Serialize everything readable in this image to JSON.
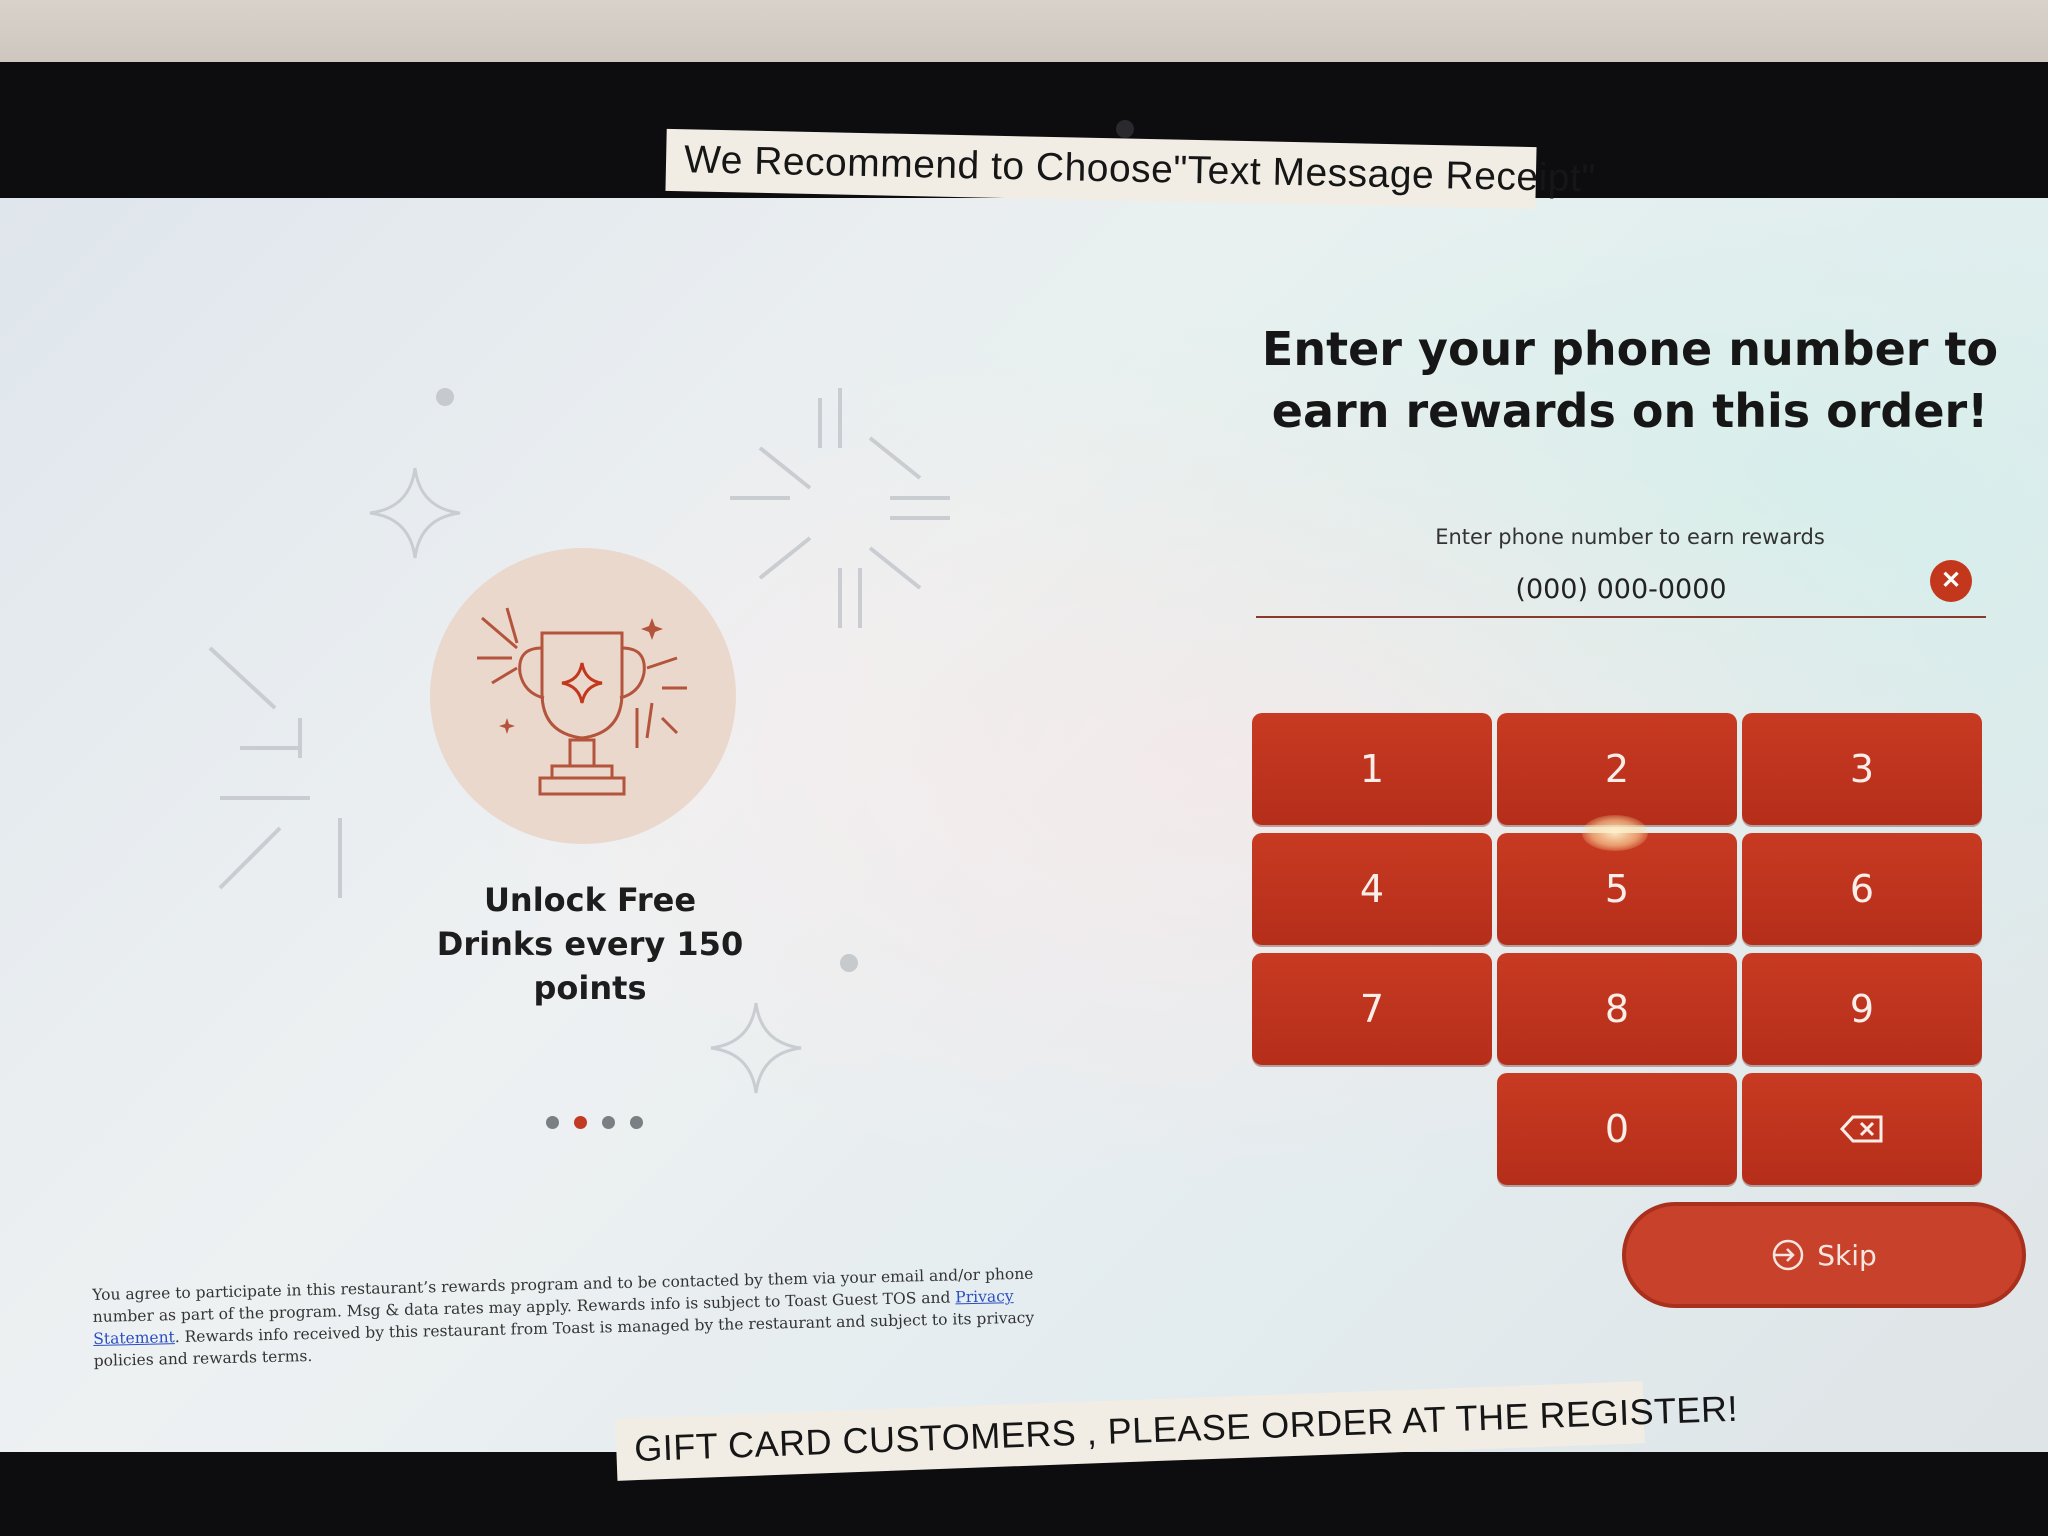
{
  "signage": {
    "top_sticker": "We Recommend to Choose\"Text Message Receipt\"",
    "bottom_sticker": "GIFT CARD CUSTOMERS , PLEASE ORDER AT THE REGISTER!"
  },
  "promo": {
    "text": "Unlock Free Drinks every 150 points",
    "icon": "trophy-icon",
    "carousel": {
      "count": 4,
      "active_index": 1
    }
  },
  "entry": {
    "heading": "Enter your phone number to earn rewards on this order!",
    "field_label": "Enter phone number to earn rewards",
    "phone_placeholder": "(000) 000-0000",
    "phone_value": "",
    "clear_icon": "close-icon",
    "keys": [
      "1",
      "2",
      "3",
      "4",
      "5",
      "6",
      "7",
      "8",
      "9",
      "0"
    ],
    "backspace_icon": "backspace-icon",
    "skip_label": "Skip",
    "skip_icon": "sign-in-arrow-icon"
  },
  "disclaimer": {
    "part1": "You agree to participate in this restaurant’s rewards program and to be contacted by them via your email and/or phone number as part of the program. Msg & data rates may apply. Rewards info is subject to Toast Guest TOS and ",
    "link": "Privacy Statement",
    "part2": ". Rewards info received by this restaurant from Toast is managed by the restaurant and subject to its privacy policies and rewards terms."
  },
  "colors": {
    "accent": "#c3381c",
    "key_background": "#c83a22",
    "active_dot": "#c23a22",
    "promo_circle": "#ead8cd"
  }
}
